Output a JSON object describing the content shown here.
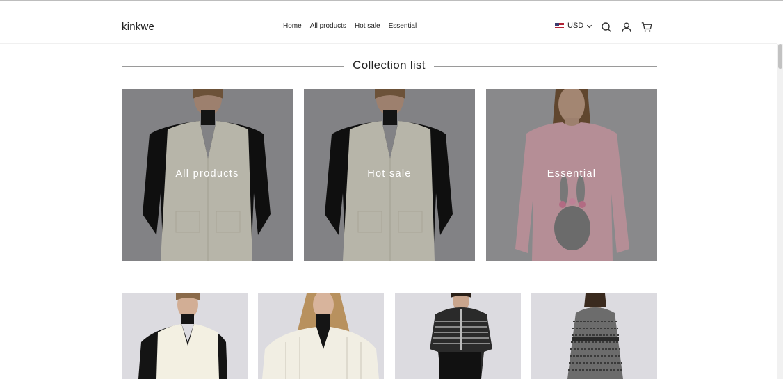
{
  "header": {
    "logo": "kinkwe",
    "nav": [
      "Home",
      "All products",
      "Hot sale",
      "Essential"
    ],
    "currency": "USD",
    "icons": [
      "search-icon",
      "account-icon",
      "cart-icon"
    ]
  },
  "section": {
    "title": "Collection list"
  },
  "collections": [
    {
      "label": "All products"
    },
    {
      "label": "Hot sale"
    },
    {
      "label": "Essential"
    }
  ],
  "products": [
    {
      "image": "cream-v-neck-knit-vest"
    },
    {
      "image": "cream-cable-knit-cardigan"
    },
    {
      "image": "black-striped-zip-jacket"
    },
    {
      "image": "houndstooth-trench-coat"
    }
  ],
  "colors": {
    "text": "#222222",
    "card_background": "#a9a9ad",
    "overlay": "rgba(0,0,0,0.22)",
    "label": "#ffffff"
  }
}
